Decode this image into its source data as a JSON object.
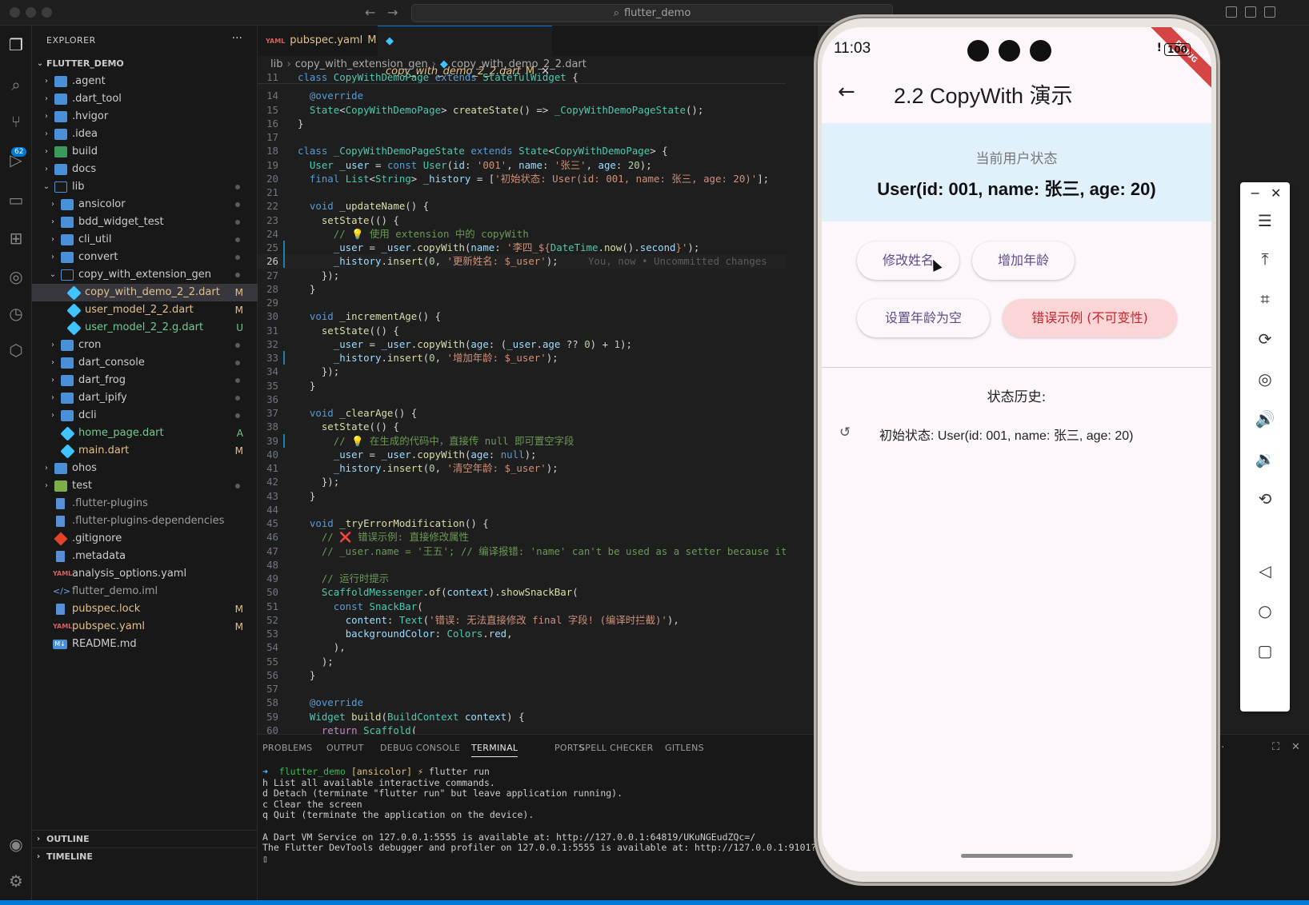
{
  "titlebar": {
    "search_text": "flutter_demo",
    "back_icon": "arrow-left-icon",
    "forward_icon": "arrow-right-icon"
  },
  "activity_bar": {
    "items": [
      "explorer-icon",
      "search-icon",
      "source-control-icon",
      "run-debug-icon",
      "remote-icon",
      "extensions-icon",
      "gitlens-icon",
      "timeline-icon",
      "database-icon",
      "account-icon",
      "settings-icon"
    ],
    "scm_badge": "62"
  },
  "sidebar": {
    "title": "EXPLORER",
    "more": "···",
    "root": "FLUTTER_DEMO",
    "items": [
      {
        "label": ".agent",
        "status": ""
      },
      {
        "label": ".dart_tool",
        "status": ""
      },
      {
        "label": ".hvigor",
        "status": ""
      },
      {
        "label": ".idea",
        "status": ""
      },
      {
        "label": "build",
        "status": ""
      },
      {
        "label": "docs",
        "status": ""
      },
      {
        "label": "lib",
        "status": ""
      },
      {
        "label": "ansicolor",
        "status": ""
      },
      {
        "label": "bdd_widget_test",
        "status": ""
      },
      {
        "label": "cli_util",
        "status": ""
      },
      {
        "label": "convert",
        "status": ""
      },
      {
        "label": "copy_with_extension_gen",
        "status": ""
      },
      {
        "label": "copy_with_demo_2_2.dart",
        "status": "M"
      },
      {
        "label": "user_model_2_2.dart",
        "status": "M"
      },
      {
        "label": "user_model_2_2.g.dart",
        "status": "U"
      },
      {
        "label": "cron",
        "status": ""
      },
      {
        "label": "dart_console",
        "status": ""
      },
      {
        "label": "dart_frog",
        "status": ""
      },
      {
        "label": "dart_ipify",
        "status": ""
      },
      {
        "label": "dcli",
        "status": ""
      },
      {
        "label": "home_page.dart",
        "status": "A"
      },
      {
        "label": "main.dart",
        "status": "M"
      },
      {
        "label": "ohos",
        "status": ""
      },
      {
        "label": "test",
        "status": ""
      },
      {
        "label": ".flutter-plugins",
        "status": ""
      },
      {
        "label": ".flutter-plugins-dependencies",
        "status": ""
      },
      {
        "label": ".gitignore",
        "status": ""
      },
      {
        "label": ".metadata",
        "status": ""
      },
      {
        "label": "analysis_options.yaml",
        "status": ""
      },
      {
        "label": "flutter_demo.iml",
        "status": ""
      },
      {
        "label": "pubspec.lock",
        "status": "M"
      },
      {
        "label": "pubspec.yaml",
        "status": "M"
      },
      {
        "label": "README.md",
        "status": ""
      }
    ],
    "outline": "OUTLINE",
    "timeline": "TIMELINE"
  },
  "editor": {
    "tabs": [
      {
        "label": "pubspec.yaml",
        "status": "M",
        "icon": "yaml"
      },
      {
        "label": "copy_with_demo_2_2.dart",
        "status": "M",
        "icon": "dart"
      }
    ],
    "breadcrumb": [
      "lib",
      "copy_with_extension_gen",
      "copy_with_demo_2_2.dart"
    ],
    "sticky_line": "11",
    "line_numbers": [
      "14",
      "15",
      "16",
      "17",
      "18",
      "19",
      "20",
      "21",
      "22",
      "23",
      "24",
      "25",
      "26",
      "27",
      "28",
      "29",
      "30",
      "31",
      "32",
      "33",
      "34",
      "35",
      "36",
      "37",
      "38",
      "39",
      "40",
      "41",
      "42",
      "43",
      "44",
      "45",
      "46",
      "47",
      "48",
      "49",
      "50",
      "51",
      "52",
      "53",
      "54",
      "55",
      "56",
      "57",
      "58",
      "59",
      "60"
    ],
    "blame": "You, now • Uncommitted changes"
  },
  "panel": {
    "tabs": [
      "PROBLEMS",
      "OUTPUT",
      "DEBUG CONSOLE",
      "TERMINAL",
      "PORTS",
      "SPELL CHECKER",
      "GITLENS"
    ],
    "active_tab": "TERMINAL",
    "prompt_dir": "flutter_demo",
    "prompt_branch": "[ansicolor]",
    "prompt_sym": "⚡",
    "command": "flutter run",
    "lines": [
      "h List all available interactive commands.",
      "d Detach (terminate \"flutter run\" but leave application running).",
      "c Clear the screen",
      "q Quit (terminate the application on the device).",
      "",
      "A Dart VM Service on 127.0.0.1:5555 is available at: http://127.0.0.1:64819/UKuNGEudZQc=/",
      "The Flutter DevTools debugger and profiler on 127.0.0.1:5555 is available at: http://127.0.0.1:9101?uri=http://127.0.0.1:64819/UKuNGEudZQc=/"
    ]
  },
  "phone": {
    "time": "11:03",
    "battery": "100",
    "debug_banner": "DEBUG",
    "title": "2.2 CopyWith 演示",
    "status_label": "当前用户状态",
    "status_value": "User(id: 001, name: 张三, age: 20)",
    "buttons": {
      "update_name": "修改姓名",
      "increment_age": "增加年龄",
      "clear_age": "设置年龄为空",
      "error_demo": "错误示例 (不可变性)"
    },
    "history_title": "状态历史:",
    "history": [
      "初始状态: User(id: 001, name: 张三, age: 20)"
    ]
  },
  "emulator_toolbar": {
    "minimize": "−",
    "close": "✕",
    "tools": [
      "menu-icon",
      "pin-icon",
      "crop-icon",
      "rotate-icon",
      "screenshot-icon",
      "volume-up-icon",
      "volume-down-icon",
      "shake-icon",
      "back-icon",
      "home-icon",
      "overview-icon"
    ]
  },
  "colors": {
    "accent": "#0078d4",
    "modified": "#e2c08d",
    "untracked": "#73c991",
    "status_card_bg": "#e1f1fb",
    "error_button_bg": "#fcd5d6",
    "error_button_text": "#c0262d"
  }
}
